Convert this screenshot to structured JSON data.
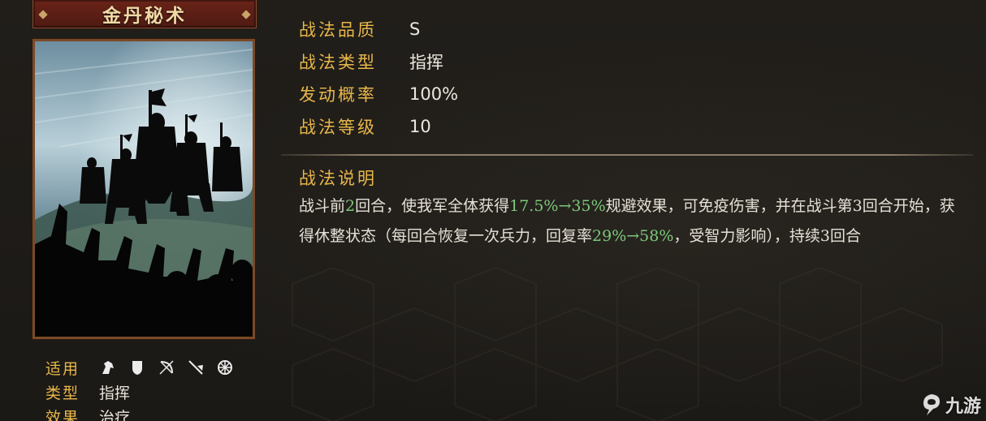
{
  "card": {
    "title": "金丹秘术"
  },
  "left_info": {
    "applicable_label": "适用",
    "troop_icons": [
      "cavalry-icon",
      "shield-icon",
      "bow-icon",
      "spear-icon",
      "chariot-icon"
    ],
    "type_label": "类型",
    "type_value": "指挥",
    "effect_label": "效果",
    "effect_value": "治疗"
  },
  "attributes": [
    {
      "label": "战法品质",
      "value": "S"
    },
    {
      "label": "战法类型",
      "value": "指挥"
    },
    {
      "label": "发动概率",
      "value": "100%"
    },
    {
      "label": "战法等级",
      "value": "10"
    }
  ],
  "description": {
    "title": "战法说明",
    "p1": "战斗前",
    "n1": "2",
    "p2": "回合，使我军全体获得",
    "n2": "17.5%→35%",
    "p3": "规避效果，可免疫伤害，并在战斗第",
    "n3": "3",
    "p4": "回合开始，获得休整状态（每回合恢复一次兵力，回复率",
    "n4": "29%→58%",
    "p5": "，受智力影响），持续",
    "n5": "3",
    "p6": "回合"
  },
  "watermark": {
    "text": "九游"
  },
  "colors": {
    "label_gold": "#e8b74a",
    "highlight_green": "#7cc87a",
    "title_red": "#5e1f15"
  }
}
